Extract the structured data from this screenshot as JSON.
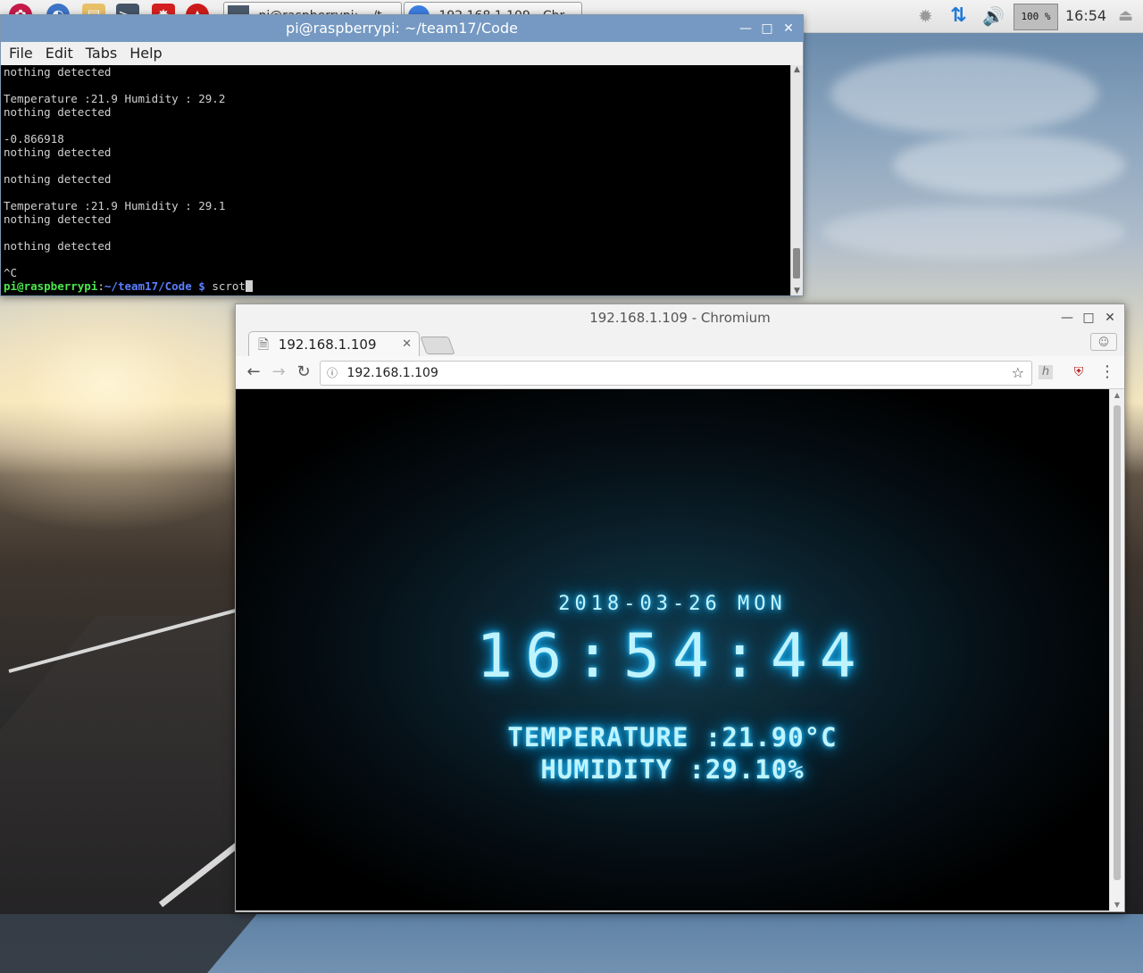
{
  "taskbar": {
    "tasks": [
      {
        "label": "pi@raspberrypi: ~/t"
      },
      {
        "label": "192.168.1.109 - Chr"
      }
    ],
    "cpu": "100 %",
    "clock": "16:54"
  },
  "terminal": {
    "title": "pi@raspberrypi: ~/team17/Code",
    "menu": [
      "File",
      "Edit",
      "Tabs",
      "Help"
    ],
    "lines": [
      "nothing detected",
      "",
      "Temperature :21.9 Humidity : 29.2",
      "nothing detected",
      "",
      "-0.866918",
      "nothing detected",
      "",
      "nothing detected",
      "",
      "Temperature :21.9 Humidity : 29.1",
      "nothing detected",
      "",
      "nothing detected",
      "",
      "^C"
    ],
    "prompt": {
      "user": "pi@raspberrypi",
      "path": "~/team17/Code",
      "symbol": "$",
      "command": "scrot"
    }
  },
  "browser": {
    "title": "192.168.1.109 - Chromium",
    "tab_title": "192.168.1.109",
    "url": "192.168.1.109",
    "page": {
      "date": "2018-03-26 MON",
      "time": "16:54:44",
      "temperature": "TEMPERATURE :21.90°C",
      "humidity": "HUMIDITY :29.10%"
    }
  },
  "colors": {
    "accent": "#7599c2",
    "glow": "#2fc4ff",
    "prompt_user": "#4ce64c",
    "prompt_path": "#5b7fff"
  }
}
